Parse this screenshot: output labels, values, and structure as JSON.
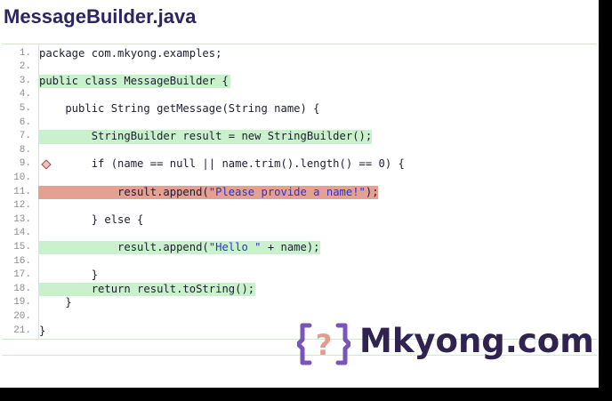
{
  "title": "MessageBuilder.java",
  "code_lines": [
    {
      "n": "1.",
      "code": "package com.mkyong.examples;",
      "hl": "",
      "hlw": 0
    },
    {
      "n": "2.",
      "code": "",
      "hl": "",
      "hlw": 0
    },
    {
      "n": "3.",
      "code": "public class MessageBuilder {",
      "hl": "green",
      "hlw": 216
    },
    {
      "n": "4.",
      "code": "",
      "hl": "",
      "hlw": 0
    },
    {
      "n": "5.",
      "code": "    public String getMessage(String name) {",
      "hl": "",
      "hlw": 0
    },
    {
      "n": "6.",
      "code": "",
      "hl": "",
      "hlw": 0
    },
    {
      "n": "7.",
      "code": "        StringBuilder result = new StringBuilder();",
      "hl": "green",
      "hlw": 375
    },
    {
      "n": "8.",
      "code": "",
      "hl": "",
      "hlw": 0
    },
    {
      "n": "9.",
      "code": "        if (name == null || name.trim().length() == 0) {",
      "hl": "",
      "hlw": 0
    },
    {
      "n": "10.",
      "code": "            result.append(",
      "str": "\"Please provide a name!\"",
      "after": ");",
      "hl": "red",
      "hlw": 382
    },
    {
      "n": "11.",
      "code": "",
      "hl": "",
      "hlw": 0
    },
    {
      "n": "12.",
      "code": "        } else {",
      "hl": "",
      "hlw": 0
    },
    {
      "n": "13.",
      "code": "",
      "hl": "",
      "hlw": 0
    },
    {
      "n": "14.",
      "code": "            result.append(",
      "str": "\"Hello \"",
      "after": " + name);",
      "hl": "green",
      "hlw": 317
    },
    {
      "n": "15.",
      "code": "",
      "hl": "",
      "hlw": 0
    },
    {
      "n": "16.",
      "code": "        }",
      "hl": "",
      "hlw": 0
    },
    {
      "n": "17.",
      "code": "        return result.toString();",
      "hl": "green",
      "hlw": 244
    },
    {
      "n": "18.",
      "code": "    }",
      "hl": "",
      "hlw": 0
    },
    {
      "n": "19.",
      "code": "",
      "hl": "",
      "hlw": 0
    },
    {
      "n": "20.",
      "code": "}",
      "hl": "",
      "hlw": 0
    }
  ],
  "line_numbers": [
    "1.",
    "2.",
    "3.",
    "4.",
    "5.",
    "6.",
    "7.",
    "8.",
    "9.",
    "10.",
    "11.",
    "12.",
    "13.",
    "14.",
    "15.",
    "16.",
    "17.",
    "18.",
    "19.",
    "20.",
    "21."
  ],
  "logo": {
    "text": "Mkyong.com",
    "mark_glyph": "?"
  },
  "colors": {
    "accent": "#7a55b8",
    "brand": "#30234f",
    "coverage_full": "#c9f2cc",
    "coverage_missed": "#e3a093",
    "string": "#2a34d6"
  }
}
